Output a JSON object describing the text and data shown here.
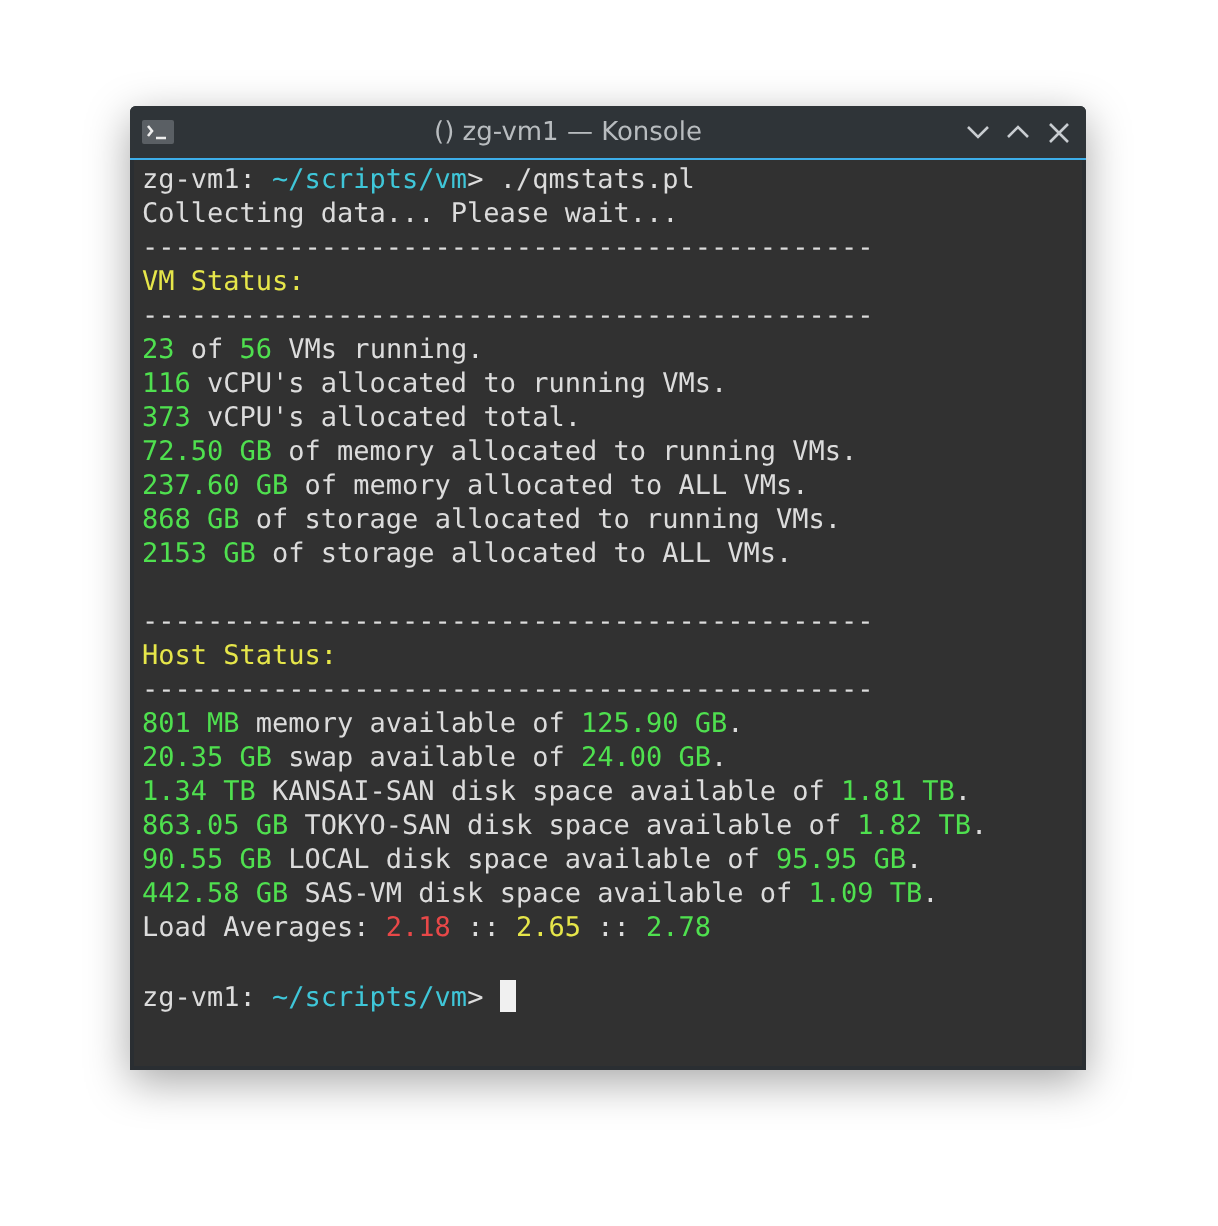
{
  "window": {
    "title": "() zg-vm1 — Konsole"
  },
  "terminal": {
    "lines": [
      {
        "kind": "text",
        "segments": [
          {
            "text": "zg-vm1: ",
            "color": "#dcdcdc"
          },
          {
            "text": "~/scripts/vm",
            "color": "#3fc6d8"
          },
          {
            "text": "> ./qmstats.pl",
            "color": "#dcdcdc"
          }
        ]
      },
      {
        "kind": "text",
        "segments": [
          {
            "text": "Collecting data... Please wait...",
            "color": "#dcdcdc"
          }
        ]
      },
      {
        "kind": "text",
        "segments": [
          {
            "text": "---------------------------------------------",
            "color": "#dcdcdc"
          }
        ]
      },
      {
        "kind": "text",
        "segments": [
          {
            "text": "VM Status:",
            "color": "#e6e64a"
          }
        ]
      },
      {
        "kind": "text",
        "segments": [
          {
            "text": "---------------------------------------------",
            "color": "#dcdcdc"
          }
        ]
      },
      {
        "kind": "text",
        "segments": [
          {
            "text": "23",
            "color": "#4fe04f"
          },
          {
            "text": " of ",
            "color": "#dcdcdc"
          },
          {
            "text": "56",
            "color": "#4fe04f"
          },
          {
            "text": " VMs running.",
            "color": "#dcdcdc"
          }
        ]
      },
      {
        "kind": "text",
        "segments": [
          {
            "text": "116",
            "color": "#4fe04f"
          },
          {
            "text": " vCPU's allocated to running VMs.",
            "color": "#dcdcdc"
          }
        ]
      },
      {
        "kind": "text",
        "segments": [
          {
            "text": "373",
            "color": "#4fe04f"
          },
          {
            "text": " vCPU's allocated total.",
            "color": "#dcdcdc"
          }
        ]
      },
      {
        "kind": "text",
        "segments": [
          {
            "text": "72.50 GB",
            "color": "#4fe04f"
          },
          {
            "text": " of memory allocated to running VMs.",
            "color": "#dcdcdc"
          }
        ]
      },
      {
        "kind": "text",
        "segments": [
          {
            "text": "237.60 GB",
            "color": "#4fe04f"
          },
          {
            "text": " of memory allocated to ALL VMs.",
            "color": "#dcdcdc"
          }
        ]
      },
      {
        "kind": "text",
        "segments": [
          {
            "text": "868 GB",
            "color": "#4fe04f"
          },
          {
            "text": " of storage allocated to running VMs.",
            "color": "#dcdcdc"
          }
        ]
      },
      {
        "kind": "text",
        "segments": [
          {
            "text": "2153 GB",
            "color": "#4fe04f"
          },
          {
            "text": " of storage allocated to ALL VMs.",
            "color": "#dcdcdc"
          }
        ]
      },
      {
        "kind": "blank"
      },
      {
        "kind": "text",
        "segments": [
          {
            "text": "---------------------------------------------",
            "color": "#dcdcdc"
          }
        ]
      },
      {
        "kind": "text",
        "segments": [
          {
            "text": "Host Status:",
            "color": "#e6e64a"
          }
        ]
      },
      {
        "kind": "text",
        "segments": [
          {
            "text": "---------------------------------------------",
            "color": "#dcdcdc"
          }
        ]
      },
      {
        "kind": "text",
        "segments": [
          {
            "text": "801 MB",
            "color": "#4fe04f"
          },
          {
            "text": " memory available of ",
            "color": "#dcdcdc"
          },
          {
            "text": "125.90 GB",
            "color": "#4fe04f"
          },
          {
            "text": ".",
            "color": "#dcdcdc"
          }
        ]
      },
      {
        "kind": "text",
        "segments": [
          {
            "text": "20.35 GB",
            "color": "#4fe04f"
          },
          {
            "text": " swap available of ",
            "color": "#dcdcdc"
          },
          {
            "text": "24.00 GB",
            "color": "#4fe04f"
          },
          {
            "text": ".",
            "color": "#dcdcdc"
          }
        ]
      },
      {
        "kind": "text",
        "segments": [
          {
            "text": "1.34 TB",
            "color": "#4fe04f"
          },
          {
            "text": " KANSAI-SAN disk space available of ",
            "color": "#dcdcdc"
          },
          {
            "text": "1.81 TB",
            "color": "#4fe04f"
          },
          {
            "text": ".",
            "color": "#dcdcdc"
          }
        ]
      },
      {
        "kind": "text",
        "segments": [
          {
            "text": "863.05 GB",
            "color": "#4fe04f"
          },
          {
            "text": " TOKYO-SAN disk space available of ",
            "color": "#dcdcdc"
          },
          {
            "text": "1.82 TB",
            "color": "#4fe04f"
          },
          {
            "text": ".",
            "color": "#dcdcdc"
          }
        ]
      },
      {
        "kind": "text",
        "segments": [
          {
            "text": "90.55 GB",
            "color": "#4fe04f"
          },
          {
            "text": " LOCAL disk space available of ",
            "color": "#dcdcdc"
          },
          {
            "text": "95.95 GB",
            "color": "#4fe04f"
          },
          {
            "text": ".",
            "color": "#dcdcdc"
          }
        ]
      },
      {
        "kind": "text",
        "segments": [
          {
            "text": "442.58 GB",
            "color": "#4fe04f"
          },
          {
            "text": " SAS-VM disk space available of ",
            "color": "#dcdcdc"
          },
          {
            "text": "1.09 TB",
            "color": "#4fe04f"
          },
          {
            "text": ".",
            "color": "#dcdcdc"
          }
        ]
      },
      {
        "kind": "text",
        "segments": [
          {
            "text": "Load Averages: ",
            "color": "#dcdcdc"
          },
          {
            "text": "2.18",
            "color": "#e84848"
          },
          {
            "text": " :: ",
            "color": "#dcdcdc"
          },
          {
            "text": "2.65",
            "color": "#e6e64a"
          },
          {
            "text": " :: ",
            "color": "#dcdcdc"
          },
          {
            "text": "2.78",
            "color": "#4fe04f"
          }
        ]
      },
      {
        "kind": "blank"
      },
      {
        "kind": "prompt",
        "segments": [
          {
            "text": "zg-vm1: ",
            "color": "#dcdcdc"
          },
          {
            "text": "~/scripts/vm",
            "color": "#3fc6d8"
          },
          {
            "text": "> ",
            "color": "#dcdcdc"
          }
        ]
      }
    ]
  }
}
